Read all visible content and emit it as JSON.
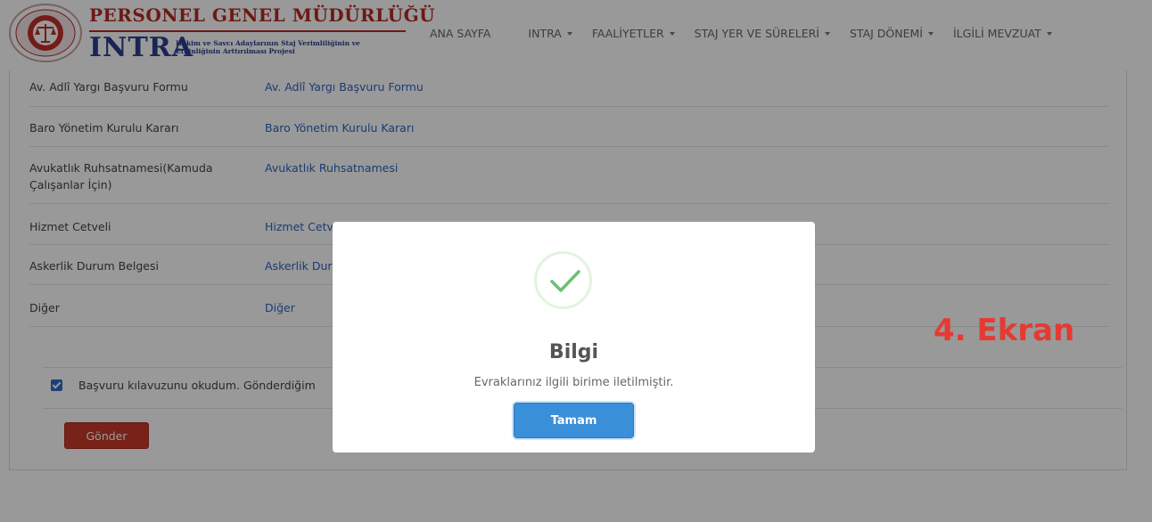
{
  "header": {
    "brand_top": "PERSONEL GENEL MÜDÜRLÜĞÜ",
    "brand_intra": "INTRA",
    "brand_sub_line1": "Hâkim ve Savcı Adaylarının Staj Verimliliğinin ve",
    "brand_sub_line2": "Etkinliğinin Arttırılması Projesi"
  },
  "nav": {
    "items": [
      {
        "label": "ANA SAYFA",
        "dropdown": false
      },
      {
        "label": "INTRA",
        "dropdown": true
      },
      {
        "label": "FAALİYETLER",
        "dropdown": true
      },
      {
        "label": "STAJ YER VE SÜRELERİ",
        "dropdown": true
      },
      {
        "label": "STAJ DÖNEMİ",
        "dropdown": true
      },
      {
        "label": "İLGİLİ MEVZUAT",
        "dropdown": true
      }
    ]
  },
  "documents": [
    {
      "label": "Av. Adlî Yargı Başvuru Formu",
      "link": "Av. Adlî Yargı Başvuru Formu"
    },
    {
      "label": "Baro Yönetim Kurulu Kararı",
      "link": "Baro Yönetim Kurulu Kararı"
    },
    {
      "label_line1": "Avukatlık Ruhsatnamesi(Kamuda",
      "label_line2": "Çalışanlar İçin)",
      "link": "Avukatlık Ruhsatnamesi"
    },
    {
      "label": "Hizmet Cetveli",
      "link": "Hizmet Cetveli"
    },
    {
      "label": "Askerlik Durum Belgesi",
      "link": "Askerlik Durum Belgesi"
    },
    {
      "label": "Diğer",
      "link": "Diğer"
    }
  ],
  "consent": {
    "checked": true,
    "text": "Başvuru kılavuzunu okudum. Gönderdiğim"
  },
  "send_button": "Gönder",
  "screen_label": "4. Ekran",
  "modal": {
    "icon": "check-icon",
    "title": "Bilgi",
    "message": "Evraklarınız ilgili birime iletilmiştir.",
    "ok_button": "Tamam"
  },
  "colors": {
    "brand_red": "#b42a25",
    "brand_blue": "#2c3e8f",
    "link_blue": "#2d63c2",
    "ok_button": "#3a8fd9",
    "send_button": "#c83a2a",
    "screen_label": "#e53a32",
    "success_green": "#6cc070"
  }
}
